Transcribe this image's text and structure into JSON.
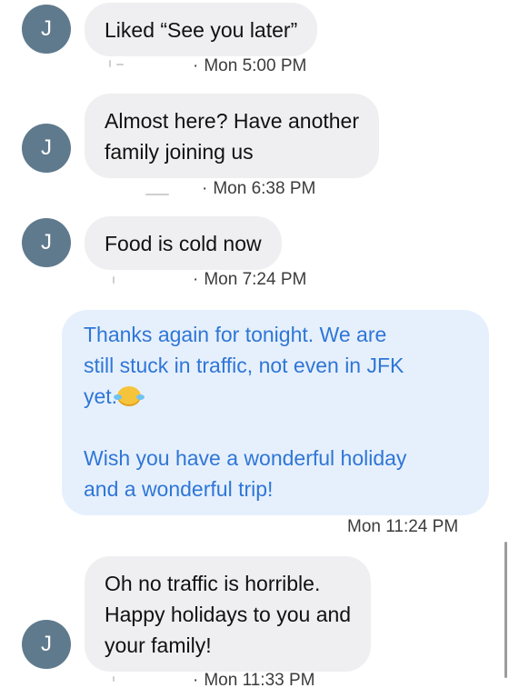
{
  "messages": [
    {
      "avatar_initial": "J",
      "text": "Liked “See you later”",
      "meta": "Mon 5:00 PM"
    },
    {
      "avatar_initial": "J",
      "text": "Almost here? Have another\nfamily joining us",
      "meta": "Mon 6:38 PM"
    },
    {
      "avatar_initial": "J",
      "text": "Food is cold now",
      "meta": "Mon 7:24 PM"
    },
    {
      "text_line1": "Thanks again for tonight. We are\nstill stuck in traffic, not even in JFK\nyet.",
      "emoji": "face-with-tears-of-joy",
      "text_line2": "Wish you have a wonderful holiday\nand a wonderful trip!",
      "meta": "Mon 11:24 PM"
    },
    {
      "avatar_initial": "J",
      "text": "Oh no traffic is horrible.\nHappy holidays to you and\nyour family!",
      "meta": "Mon 11:33 PM"
    }
  ],
  "colors": {
    "avatar_bg": "#5f7a8d",
    "incoming_bubble_bg": "#efeff1",
    "outgoing_bubble_bg": "#e6f0fd",
    "outgoing_text": "#2f76d6"
  }
}
